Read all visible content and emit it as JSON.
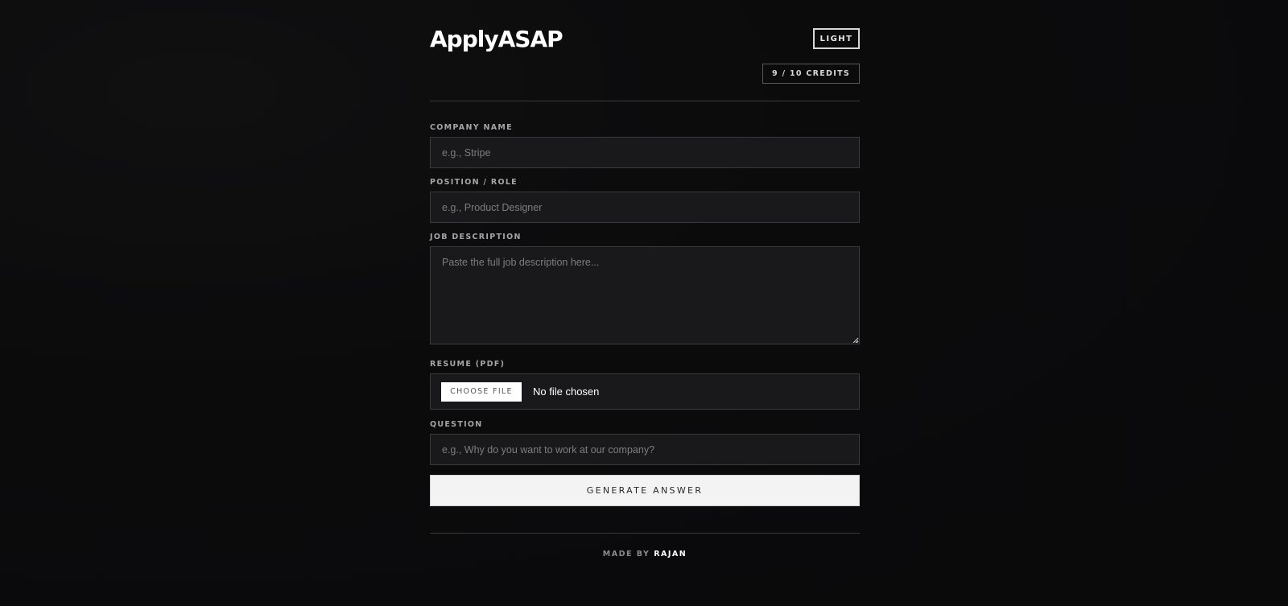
{
  "header": {
    "logo": "ApplyASAP",
    "theme_toggle_label": "LIGHT",
    "credits_label": "9 / 10 CREDITS"
  },
  "form": {
    "company": {
      "label": "COMPANY NAME",
      "placeholder": "e.g., Stripe",
      "value": ""
    },
    "position": {
      "label": "POSITION / ROLE",
      "placeholder": "e.g., Product Designer",
      "value": ""
    },
    "job_description": {
      "label": "JOB DESCRIPTION",
      "placeholder": "Paste the full job description here...",
      "value": ""
    },
    "resume": {
      "label": "RESUME (PDF)",
      "button_label": "CHOOSE FILE",
      "status": "No file chosen"
    },
    "question": {
      "label": "QUESTION",
      "placeholder": "e.g., Why do you want to work at our company?",
      "value": ""
    },
    "submit_label": "GENERATE ANSWER"
  },
  "footer": {
    "made_by_prefix": "MADE BY",
    "author": "RAJAN"
  },
  "colors": {
    "background": "#0b0b0c",
    "input_background": "#19191b",
    "input_border": "#3a3a3d",
    "button_background": "#f3f3f3",
    "label_text": "#a5a5a8"
  }
}
